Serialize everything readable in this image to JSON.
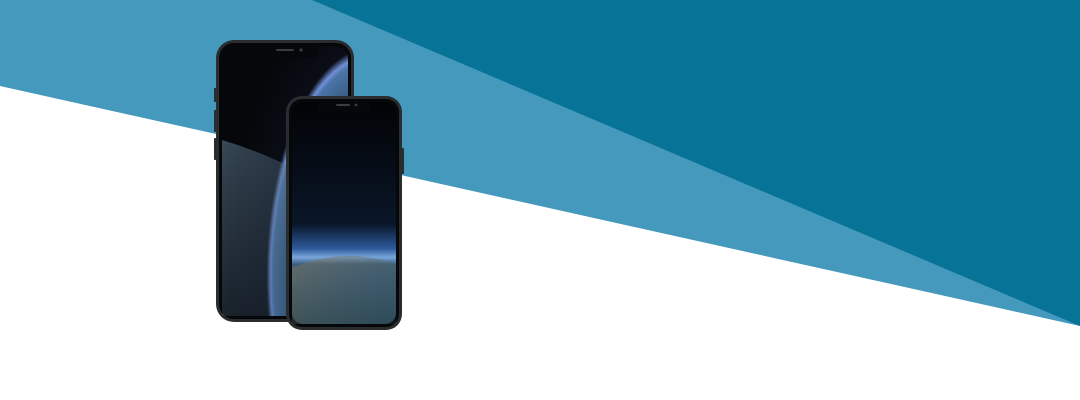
{
  "banner": {
    "background_color": "#ffffff",
    "light_band_color": "#4599bd",
    "dark_band_color": "#077497"
  },
  "devices": [
    {
      "name": "large-phone",
      "frame_color": "#2a2d30",
      "screen": "earth-horizon-wallpaper"
    },
    {
      "name": "small-phone",
      "frame_color": "#2a2d30",
      "screen": "earth-horizon-wallpaper"
    }
  ]
}
